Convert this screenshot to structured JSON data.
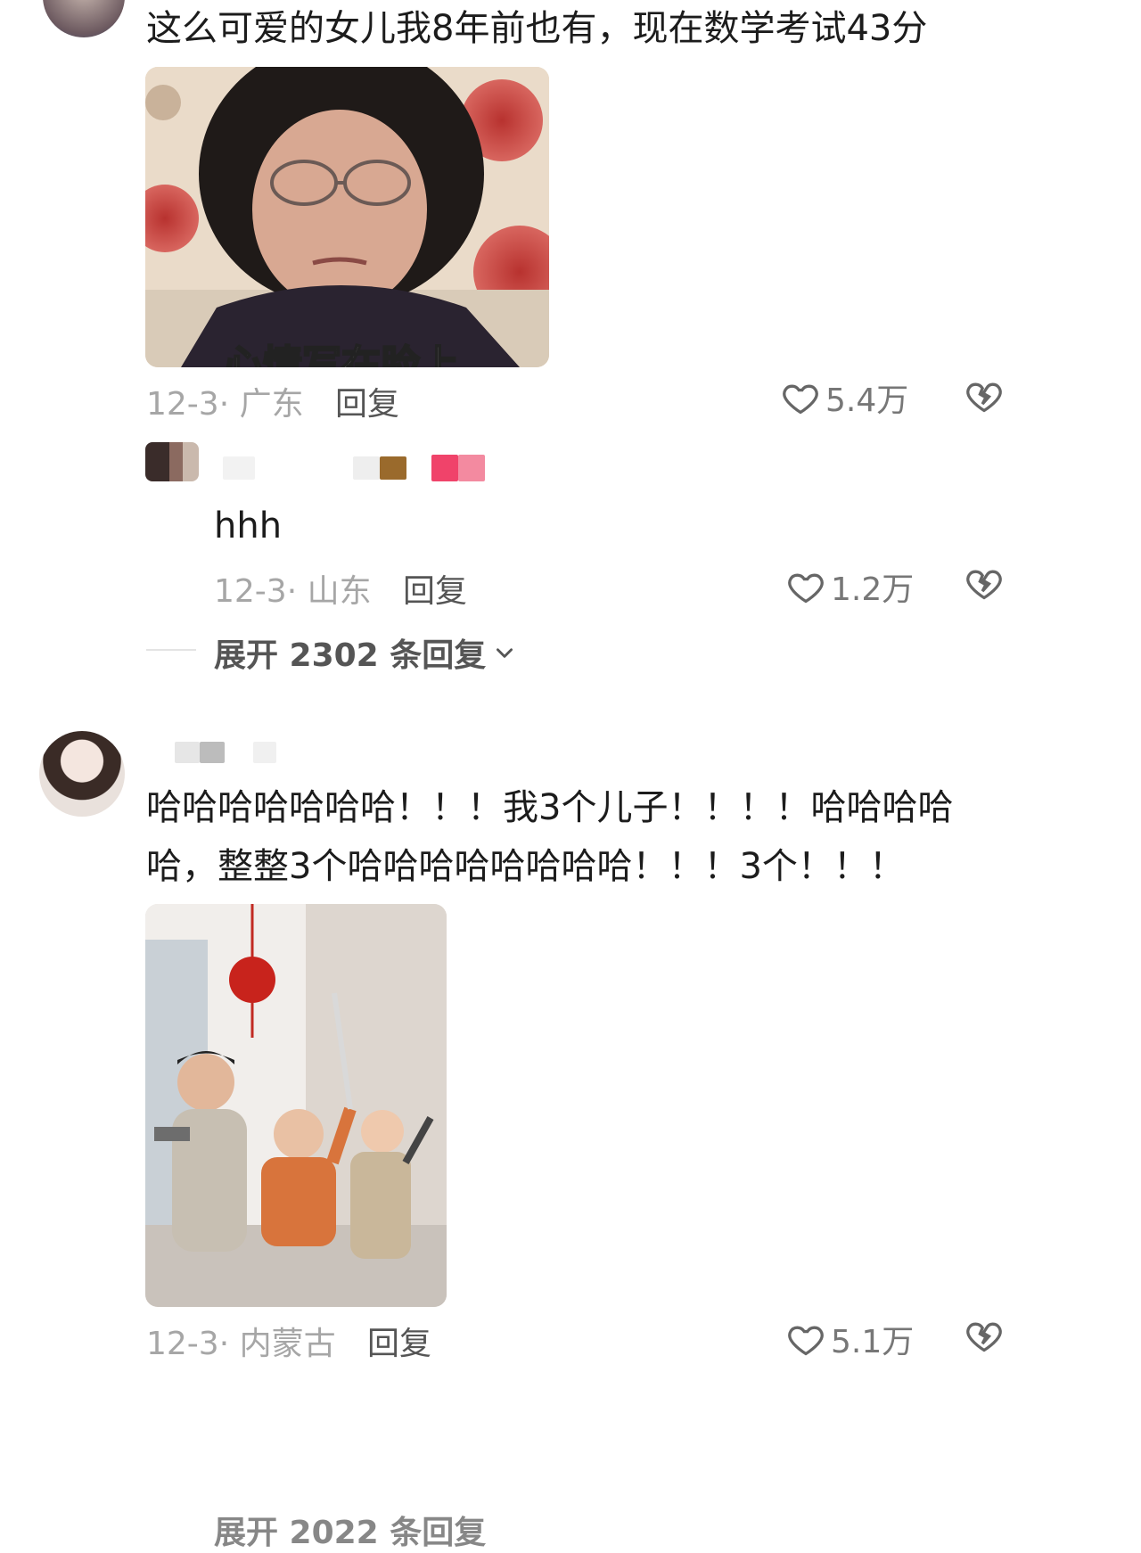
{
  "comments": [
    {
      "text": "这么可爱的女儿我8年前也有，现在数学考试43分",
      "image": {
        "caption": "心情写在脸上"
      },
      "date_location": "12-3· 广东",
      "reply_label": "回复",
      "likes": "5.4万"
    },
    {
      "text_lines": [
        "哈哈哈哈哈哈哈！！！我3个儿子！！！！哈哈哈哈",
        "哈，整整3个哈哈哈哈哈哈哈哈！！！3个！！！"
      ],
      "date_location": "12-3· 内蒙古",
      "reply_label": "回复",
      "likes": "5.1万"
    }
  ],
  "sub_reply": {
    "text": "hhh",
    "date_location": "12-3· 山东",
    "reply_label": "回复",
    "likes": "1.2万"
  },
  "expand_replies": "展开 2302 条回复",
  "expand_replies_partial": "展开 2022 条回复",
  "colors": {
    "meta": "#a6a6a6",
    "text": "#1c1c1c",
    "icon": "#666666"
  },
  "icons": [
    "heart-icon",
    "dislike-icon",
    "chevron-down-icon"
  ]
}
